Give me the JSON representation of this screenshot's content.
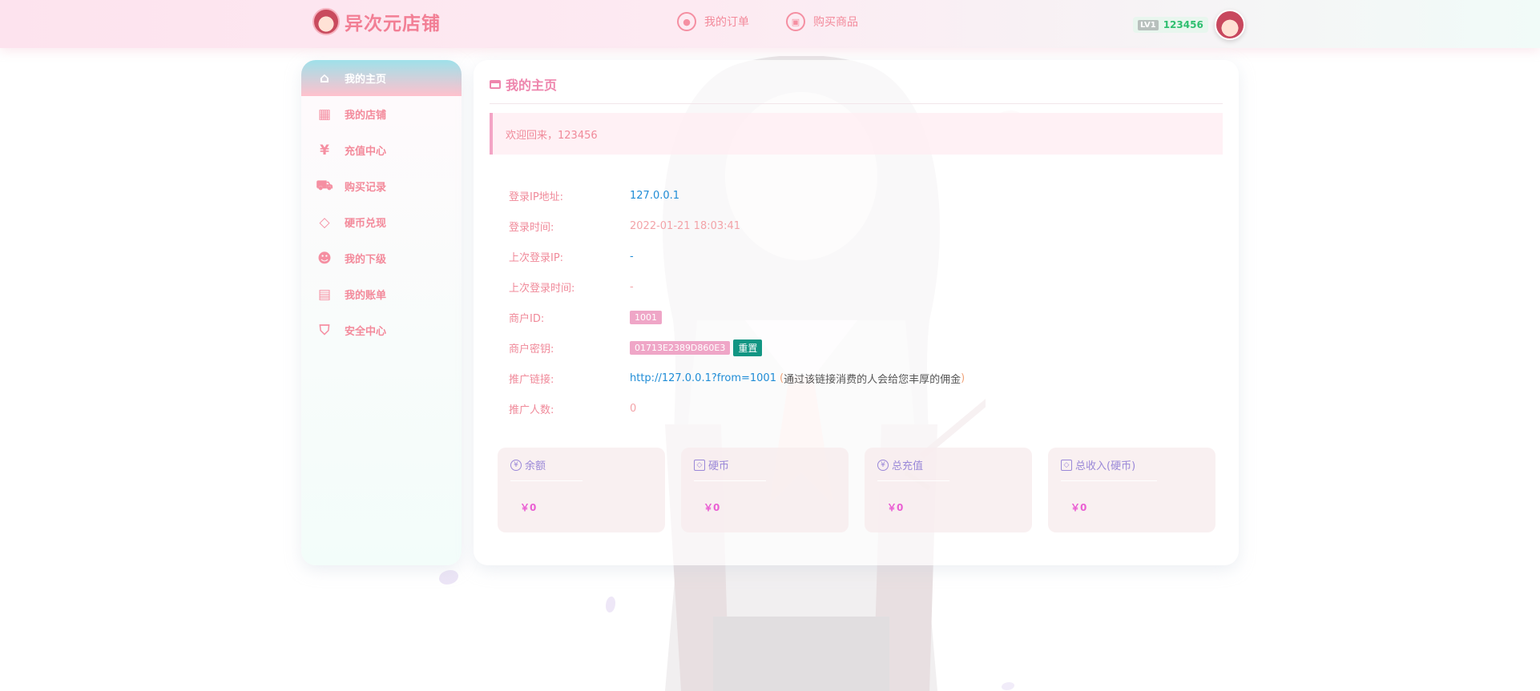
{
  "header": {
    "brand": "异次元店铺",
    "nav": [
      {
        "label": "我的订单",
        "icon": "order-icon"
      },
      {
        "label": "购买商品",
        "icon": "shop-icon"
      }
    ],
    "user": {
      "level": "LV1",
      "name": "123456"
    }
  },
  "sidebar": {
    "items": [
      {
        "label": "我的主页",
        "icon": "home-icon",
        "active": true
      },
      {
        "label": "我的店铺",
        "icon": "store-grid-icon"
      },
      {
        "label": "充值中心",
        "icon": "yen-circle-icon"
      },
      {
        "label": "购买记录",
        "icon": "cart-icon"
      },
      {
        "label": "硬币兑现",
        "icon": "diamond-icon"
      },
      {
        "label": "我的下级",
        "icon": "user-icon"
      },
      {
        "label": "我的账单",
        "icon": "clipboard-icon"
      },
      {
        "label": "安全中心",
        "icon": "shield-icon"
      }
    ]
  },
  "main": {
    "title": "我的主页",
    "welcome": "欢迎回来，123456",
    "info": {
      "login_ip_label": "登录IP地址:",
      "login_ip": "127.0.0.1",
      "login_time_label": "登录时间:",
      "login_time": "2022-01-21 18:03:41",
      "last_ip_label": "上次登录IP:",
      "last_ip": "-",
      "last_time_label": "上次登录时间:",
      "last_time": "-",
      "merchant_id_label": "商户ID:",
      "merchant_id": "1001",
      "merchant_key_label": "商户密钥:",
      "merchant_key": "01713E2389D860E3",
      "reset_label": "重置",
      "promo_link_label": "推广链接:",
      "promo_link": "http://127.0.0.1?from=1001",
      "promo_note_open": "(",
      "promo_note": "通过该链接消费的人会给您丰厚的佣金",
      "promo_note_close": ")",
      "promo_count_label": "推广人数:",
      "promo_count": "0"
    },
    "stats": [
      {
        "label": "余额",
        "value": "￥0",
        "icon": "yen-icon"
      },
      {
        "label": "硬币",
        "value": "￥0",
        "icon": "diamond-icon"
      },
      {
        "label": "总充值",
        "value": "￥0",
        "icon": "yen-icon"
      },
      {
        "label": "总收入(硬币)",
        "value": "￥0",
        "icon": "diamond-icon"
      }
    ]
  },
  "colors": {
    "accent_pink": "#f38a9b",
    "active_gradient_top": "#9fe1ea",
    "active_gradient_bottom": "#ffc1cd",
    "link_blue": "#1f8cd6",
    "reset_green": "#129683",
    "stat_value": "#ea5fd3"
  }
}
